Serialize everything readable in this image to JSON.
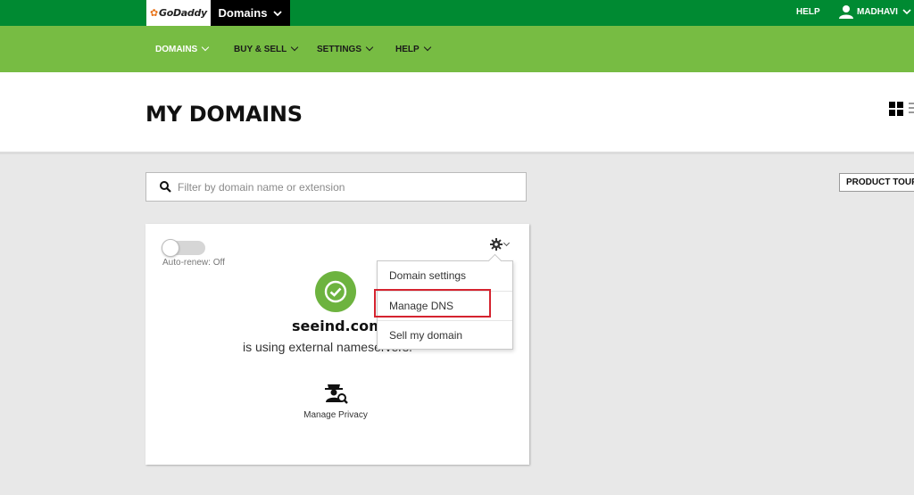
{
  "topbar": {
    "logo_text": "GoDaddy",
    "app_switcher_label": "Domains",
    "help_label": "HELP",
    "user_name": "MADHAVI",
    "color": "#008a32"
  },
  "nav": {
    "items": [
      {
        "label": "DOMAINS",
        "active": true
      },
      {
        "label": "BUY & SELL",
        "active": false
      },
      {
        "label": "SETTINGS",
        "active": false
      },
      {
        "label": "HELP",
        "active": false
      }
    ],
    "color": "#77bc43"
  },
  "page": {
    "title": "MY DOMAINS",
    "view_icons": [
      "grid-view-icon",
      "list-view-icon"
    ]
  },
  "search": {
    "placeholder": "Filter by domain name or extension",
    "value": ""
  },
  "product_tour_label": "PRODUCT TOUR",
  "card": {
    "auto_renew_label": "Auto-renew: Off",
    "auto_renew_on": false,
    "status_icon": "check-circle-icon",
    "status_color": "#6db33f",
    "domain": "seeind.com",
    "status_text": "is using external nameservers.",
    "privacy_label": "Manage Privacy"
  },
  "dropdown": {
    "items": [
      "Domain settings",
      "Manage DNS",
      "Sell my domain"
    ],
    "highlighted": "Manage DNS",
    "highlight_color": "#d5232f"
  }
}
